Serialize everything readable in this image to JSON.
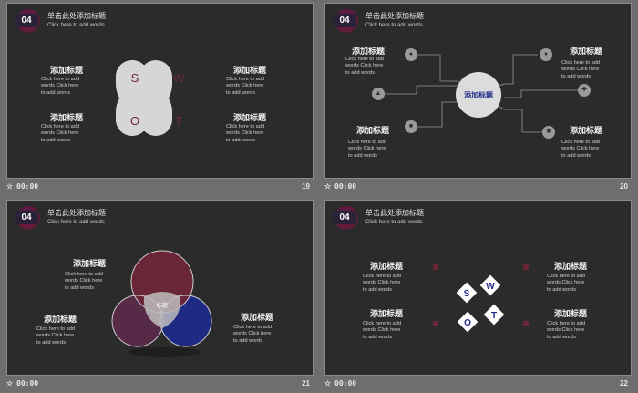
{
  "slides": [
    {
      "num_badge": "04",
      "header_title": "单击此处添加标题",
      "header_sub": "Click here to add words",
      "swot": [
        "S",
        "W",
        "O",
        "T"
      ],
      "blocks": [
        {
          "title": "添加标题",
          "text": "Click here to add words Click here to add words"
        },
        {
          "title": "添加标题",
          "text": "Click here to add words Click here to add words"
        },
        {
          "title": "添加标题",
          "text": "Click here to add words Click here to add words"
        },
        {
          "title": "添加标题",
          "text": "Click here to add words Click here to add words"
        }
      ],
      "footer_time": "00:00",
      "page_number": "19"
    },
    {
      "num_badge": "04",
      "header_title": "单击此处添加标题",
      "header_sub": "Click here to add words",
      "center_label": "添加标题",
      "icons": [
        "person-icon",
        "thumb-up-icon",
        "lock-icon",
        "bulb-icon",
        "wrench-icon",
        "gear-icon"
      ],
      "blocks": [
        {
          "title": "添加标题",
          "text": "Click here to add words Click here to add words"
        },
        {
          "title": "添加标题",
          "text": "Click here to add words Click here to add words"
        },
        {
          "title": "添加标题",
          "text": "Click here to add words Click here to add words"
        },
        {
          "title": "添加标题",
          "text": "Click here to add words Click here to add words"
        }
      ],
      "footer_time": "00:00",
      "page_number": "20"
    },
    {
      "num_badge": "04",
      "header_title": "单击此处添加标题",
      "header_sub": "Click here to add words",
      "venn_label": "标题",
      "blocks": [
        {
          "title": "添加标题",
          "text": "Click here to add words Click here to add words"
        },
        {
          "title": "添加标题",
          "text": "Click here to add words Click here to add words"
        },
        {
          "title": "添加标题",
          "text": "Click here to add words Click here to add words"
        }
      ],
      "footer_time": "00:00",
      "page_number": "21"
    },
    {
      "num_badge": "04",
      "header_title": "单击此处添加标题",
      "header_sub": "Click here to add words",
      "swot": [
        "S",
        "W",
        "O",
        "T"
      ],
      "blocks": [
        {
          "title": "添加标题",
          "text": "Click here to add words Click here to add words"
        },
        {
          "title": "添加标题",
          "text": "Click here to add words Click here to add words"
        },
        {
          "title": "添加标题",
          "text": "Click here to add words Click here to add words"
        },
        {
          "title": "添加标题",
          "text": "Click here to add words Click here to add words"
        }
      ],
      "footer_time": "00:00",
      "page_number": "22"
    }
  ],
  "footer_star": "☆",
  "colors": {
    "maroon": "#6b2637",
    "blue": "#1f2a8a",
    "purple": "#5a2a4a",
    "panel_bg": "#2b2b2b"
  }
}
